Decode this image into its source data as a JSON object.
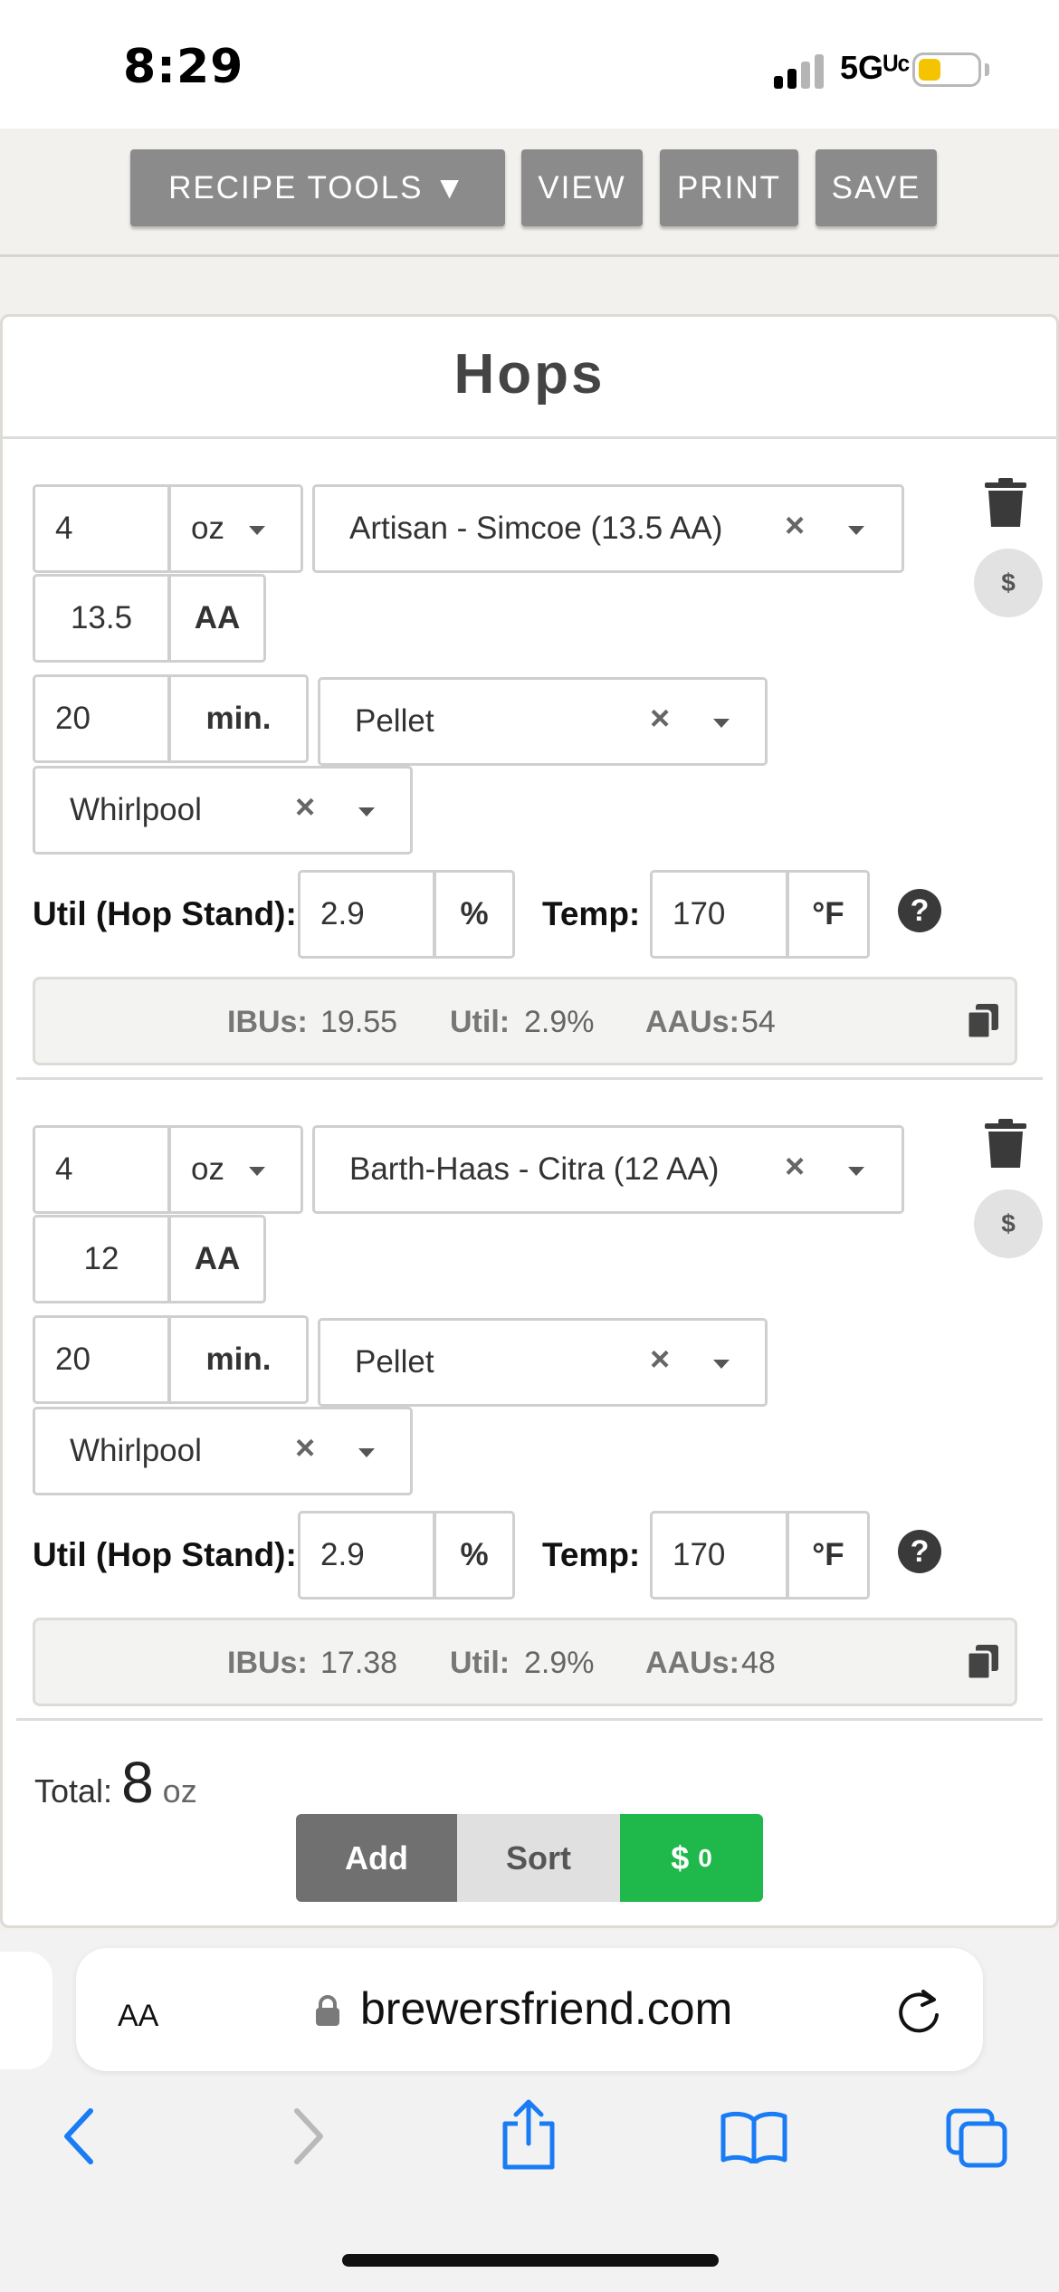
{
  "status_bar": {
    "time": "8:29",
    "network": "5Gᵁᶜ"
  },
  "toolbar": {
    "recipe_tools": "RECIPE TOOLS ▼",
    "view": "VIEW",
    "print": "PRINT",
    "save": "SAVE"
  },
  "section": {
    "title": "Hops"
  },
  "hops": [
    {
      "amount": "4",
      "unit": "oz",
      "variety": "Artisan - Simcoe (13.5 AA)",
      "aa": "13.5",
      "aa_label": "AA",
      "time": "20",
      "time_unit": "min.",
      "form": "Pellet",
      "use": "Whirlpool",
      "util_label": "Util (Hop Stand):",
      "util": "2.9",
      "util_unit": "%",
      "temp_label": "Temp:",
      "temp": "170",
      "temp_unit": "°F",
      "ibus_label": "IBUs:",
      "ibus": "19.55",
      "util_info_label": "Util:",
      "util_info": "2.9%",
      "aaus_label": "AAUs:",
      "aaus": "54",
      "dollar": "$"
    },
    {
      "amount": "4",
      "unit": "oz",
      "variety": "Barth-Haas - Citra (12 AA)",
      "aa": "12",
      "aa_label": "AA",
      "time": "20",
      "time_unit": "min.",
      "form": "Pellet",
      "use": "Whirlpool",
      "util_label": "Util (Hop Stand):",
      "util": "2.9",
      "util_unit": "%",
      "temp_label": "Temp:",
      "temp": "170",
      "temp_unit": "°F",
      "ibus_label": "IBUs:",
      "ibus": "17.38",
      "util_info_label": "Util:",
      "util_info": "2.9%",
      "aaus_label": "AAUs:",
      "aaus": "48",
      "dollar": "$"
    }
  ],
  "summary": {
    "total_label": "Total:",
    "total_value": "8",
    "total_unit": "oz"
  },
  "actions": {
    "add": "Add",
    "sort": "Sort",
    "cost": "$",
    "cost_value": "0"
  },
  "browser": {
    "aa_label": "AA",
    "url": "brewersfriend.com"
  },
  "colors": {
    "toolbar_button": "#8b8b8b",
    "cost_button": "#1fb84b",
    "add_button": "#707070",
    "ios_blue": "#1a7cf5"
  },
  "icons": [
    "trash-icon",
    "dollar-icon",
    "help-icon",
    "copy-icon",
    "lock-icon",
    "reload-icon",
    "back-icon",
    "forward-icon",
    "share-icon",
    "bookmarks-icon",
    "tabs-icon"
  ]
}
